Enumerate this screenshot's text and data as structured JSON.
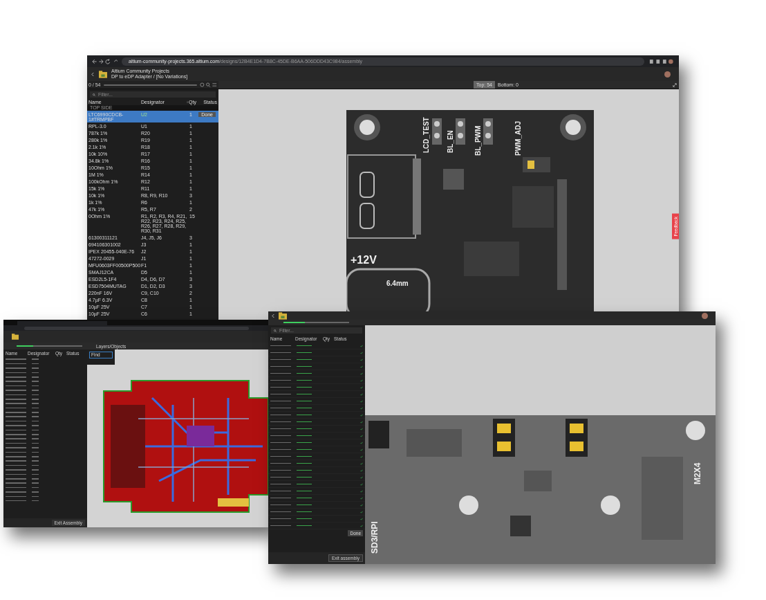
{
  "main_window": {
    "url": {
      "host": "altium-community-projects.365.altium.com",
      "path": "/designs/12B4E1D4-7B8C-45DE-B6AA-506DDD43C984/assembly"
    },
    "project": "Altium Community Projects",
    "design": "DP to eDP Adapter / [No Variations]",
    "progress": {
      "count": "0 / 54",
      "level": 0
    },
    "sides": [
      {
        "label": "Top: 54",
        "selected": true
      },
      {
        "label": "Bottom: 0",
        "selected": false
      }
    ],
    "filter": {
      "placeholder": "Filter..."
    },
    "columns": [
      "Name",
      "Designator",
      "Qty",
      "Status"
    ],
    "group": "TOP SIDE",
    "rows": [
      {
        "name": "LTC6990CDCB-1#TRMPBF",
        "designator": "U2",
        "qty": "1",
        "selected": true,
        "action": "Done"
      },
      {
        "name": "RPL-3.0",
        "designator": "U1",
        "qty": "1",
        "selected": false
      },
      {
        "name": "787k 1%",
        "designator": "R20",
        "qty": "1",
        "selected": false
      },
      {
        "name": "280k 1%",
        "designator": "R19",
        "qty": "1",
        "selected": false
      },
      {
        "name": "2.1k 1%",
        "designator": "R18",
        "qty": "1",
        "selected": false
      },
      {
        "name": "10k 10%",
        "designator": "R17",
        "qty": "1",
        "selected": false
      },
      {
        "name": "34.8k 1%",
        "designator": "R16",
        "qty": "1",
        "selected": false
      },
      {
        "name": "10Ohm 1%",
        "designator": "R15",
        "qty": "1",
        "selected": false
      },
      {
        "name": "1M 1%",
        "designator": "R14",
        "qty": "1",
        "selected": false
      },
      {
        "name": "100kOhm 1%",
        "designator": "R12",
        "qty": "1",
        "selected": false
      },
      {
        "name": "15k 1%",
        "designator": "R11",
        "qty": "1",
        "selected": false
      },
      {
        "name": "10k 1%",
        "designator": "R8, R9, R10",
        "qty": "3",
        "selected": false
      },
      {
        "name": "1k 1%",
        "designator": "R6",
        "qty": "1",
        "selected": false
      },
      {
        "name": "47k 1%",
        "designator": "R5, R7",
        "qty": "2",
        "selected": false
      },
      {
        "name": "0Ohm 1%",
        "designator": "R1, R2, R3, R4, R21, R22, R23, R24, R25, R26, R27, R28, R29, R30, R31",
        "qty": "15",
        "selected": false
      },
      {
        "name": "61300311121",
        "designator": "J4, J5, J6",
        "qty": "3",
        "selected": false
      },
      {
        "name": "694106301002",
        "designator": "J3",
        "qty": "1",
        "selected": false
      },
      {
        "name": "IPEX 20455-040E-76",
        "designator": "J2",
        "qty": "1",
        "selected": false
      },
      {
        "name": "47272-0029",
        "designator": "J1",
        "qty": "1",
        "selected": false
      },
      {
        "name": "MFU0603FF00500P500",
        "designator": "F1",
        "qty": "1",
        "selected": false
      },
      {
        "name": "SMAJ12CA",
        "designator": "D5",
        "qty": "1",
        "selected": false
      },
      {
        "name": "ESD2L5-1F4",
        "designator": "D4, D6, D7",
        "qty": "3",
        "selected": false
      },
      {
        "name": "ESD7504MUTAG",
        "designator": "D1, D2, D3",
        "qty": "3",
        "selected": false
      },
      {
        "name": "220nF 16V",
        "designator": "C9, C10",
        "qty": "2",
        "selected": false
      },
      {
        "name": "4.7µF 6.3V",
        "designator": "C8",
        "qty": "1",
        "selected": false
      },
      {
        "name": "10µF 25V",
        "designator": "C7",
        "qty": "1",
        "selected": false
      },
      {
        "name": "10µF 25V",
        "designator": "C6",
        "qty": "1",
        "selected": false
      }
    ],
    "board_labels": [
      "LCD_TEST",
      "BL_EN",
      "BL_PWM",
      "PWM_ADJ",
      "+12V",
      "6.4mm"
    ],
    "feedback": "Feedback"
  },
  "left_window": {
    "progress": {
      "level": 0.25
    },
    "columns": [
      "Name",
      "Designator",
      "Qty",
      "Status"
    ],
    "layers_button": "Layers/Objects",
    "find_field": {
      "value": "Find"
    },
    "exit_button": "Exit Assembly"
  },
  "right_window": {
    "progress": {
      "level": 0.33
    },
    "filter": {
      "placeholder": "Filter..."
    },
    "columns": [
      "Name",
      "Designator",
      "Qty",
      "Status"
    ],
    "rows": [
      {
        "done": true
      },
      {
        "done": true
      },
      {
        "done": true
      },
      {
        "done": true
      },
      {
        "done": true
      },
      {
        "done": true
      },
      {
        "done": true
      },
      {
        "done": true
      },
      {
        "done": true
      },
      {
        "done": true
      },
      {
        "done": true
      },
      {
        "done": true
      },
      {
        "done": true
      },
      {
        "done": true
      },
      {
        "done": true
      },
      {
        "done": true
      },
      {
        "done": true
      },
      {
        "done": true
      },
      {
        "done": true
      },
      {
        "done": true
      },
      {
        "done": true
      },
      {
        "done": true
      },
      {
        "done": true
      },
      {
        "done": true
      },
      {
        "done": true
      },
      {
        "done": true
      },
      {
        "done": true
      }
    ],
    "done_button": "Done",
    "exit_button": "Exit assembly",
    "board_labels": [
      "SD3/RPI",
      "M2X4"
    ]
  }
}
